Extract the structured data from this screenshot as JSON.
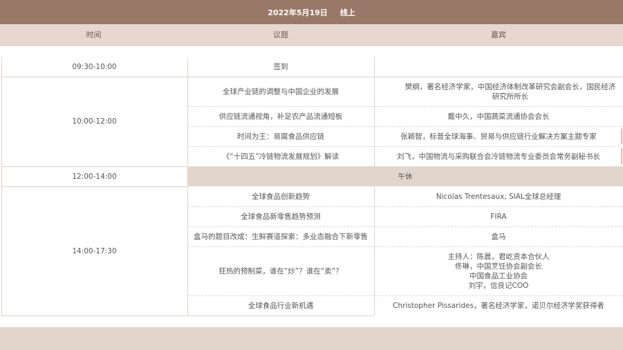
{
  "title": {
    "date": "2022年5月19日",
    "mode": "线上"
  },
  "headers": {
    "time": "时间",
    "topic": "议题",
    "guest": "嘉宾"
  },
  "rows": [
    {
      "time": "09:30-10:00",
      "topic": "签到",
      "guest": ""
    },
    {
      "time": "10:00-12:00",
      "items": [
        {
          "topic": "全球产业链的调整与中国企业的发展",
          "guest": "樊纲，著名经济学家，中国经济体制改革研究会副会长，国民经济研究所所长"
        },
        {
          "topic": "供应链流通视角，补足农产品流通短板",
          "guest": "戴中久，中国蔬菜流通协会会长"
        },
        {
          "topic": "时间为王：易腐食品供应链",
          "guest": "张颖智，标普全球海事、贸易与供应链行业解决方案主题专家"
        },
        {
          "topic": "《“十四五”冷链物流发展规划》解读",
          "guest": "刘飞，中国物流与采购联合会冷链物流专业委员会常务副秘书长"
        }
      ]
    },
    {
      "time": "12:00-14:00",
      "break": "午休"
    },
    {
      "time": "14:00-17:30",
      "items": [
        {
          "topic": "全球食品创新趋势",
          "guest": "Nicolas Trentesaux, SIAL全球总经理"
        },
        {
          "topic": "全球食品新零售趋势预测",
          "guest": "FIRA"
        },
        {
          "topic": "盒马的题目改成：生鲜赛道探索：多业态融合下新零售",
          "guest": "盒马"
        },
        {
          "topic": "狂热的预制菜，谁在“炒”？谁在“卖”？",
          "guest_lines": [
            "主持人：陈晨，君屹资本合伙人",
            "佟琳，中国烹饪协会副会长",
            "中国食品工业协会",
            "刘宇，信良记COO"
          ]
        },
        {
          "topic": "全球食品行业新机遇",
          "guest": "Christopher Pissarides，著名经济学家，诺贝尔经济学奖获得者"
        }
      ]
    }
  ]
}
